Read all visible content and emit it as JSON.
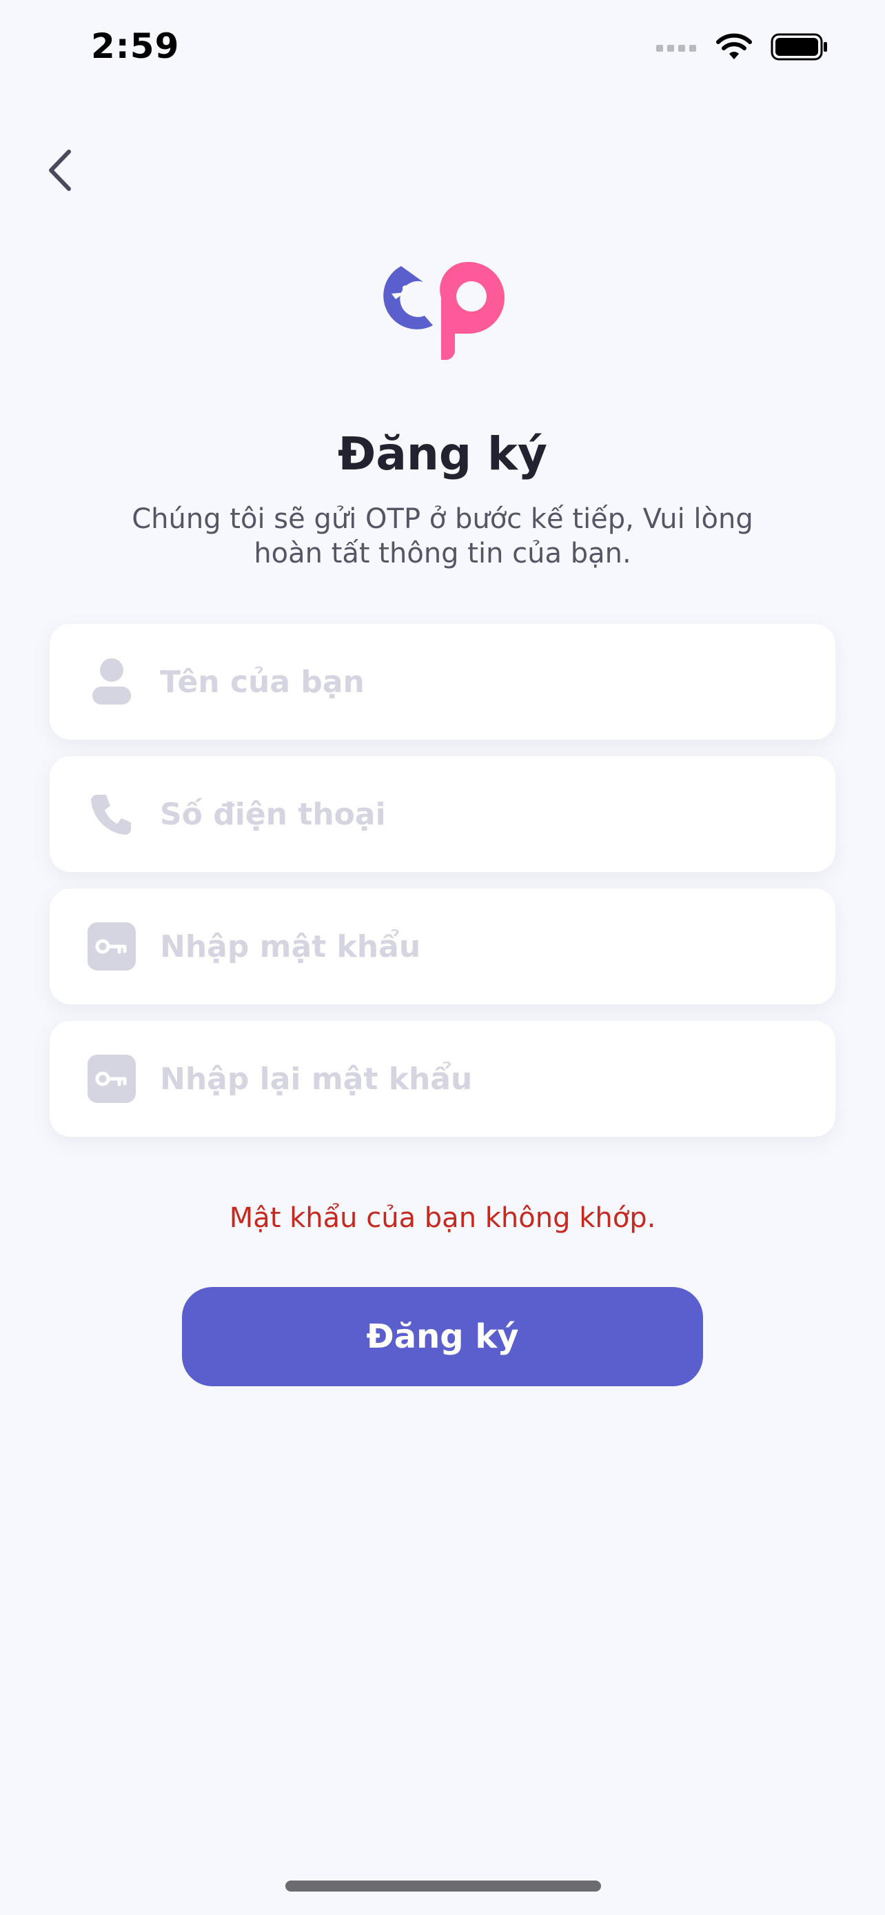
{
  "status_bar": {
    "time": "2:59"
  },
  "brand": {
    "primary": "#5a5fcd",
    "accent": "#fc5a98"
  },
  "page": {
    "title": "Đăng ký",
    "subtitle": "Chúng tôi sẽ gửi OTP ở bước kế tiếp, Vui lòng hoàn tất thông tin của bạn."
  },
  "form": {
    "fields": [
      {
        "icon": "user-icon",
        "placeholder": "Tên của bạn",
        "value": ""
      },
      {
        "icon": "phone-icon",
        "placeholder": "Số điện thoại",
        "value": ""
      },
      {
        "icon": "key-icon",
        "placeholder": "Nhập mật khẩu",
        "value": ""
      },
      {
        "icon": "key-icon",
        "placeholder": "Nhập lại mật khẩu",
        "value": ""
      }
    ],
    "error": "Mật khẩu của bạn không khớp.",
    "submit_label": "Đăng ký"
  }
}
